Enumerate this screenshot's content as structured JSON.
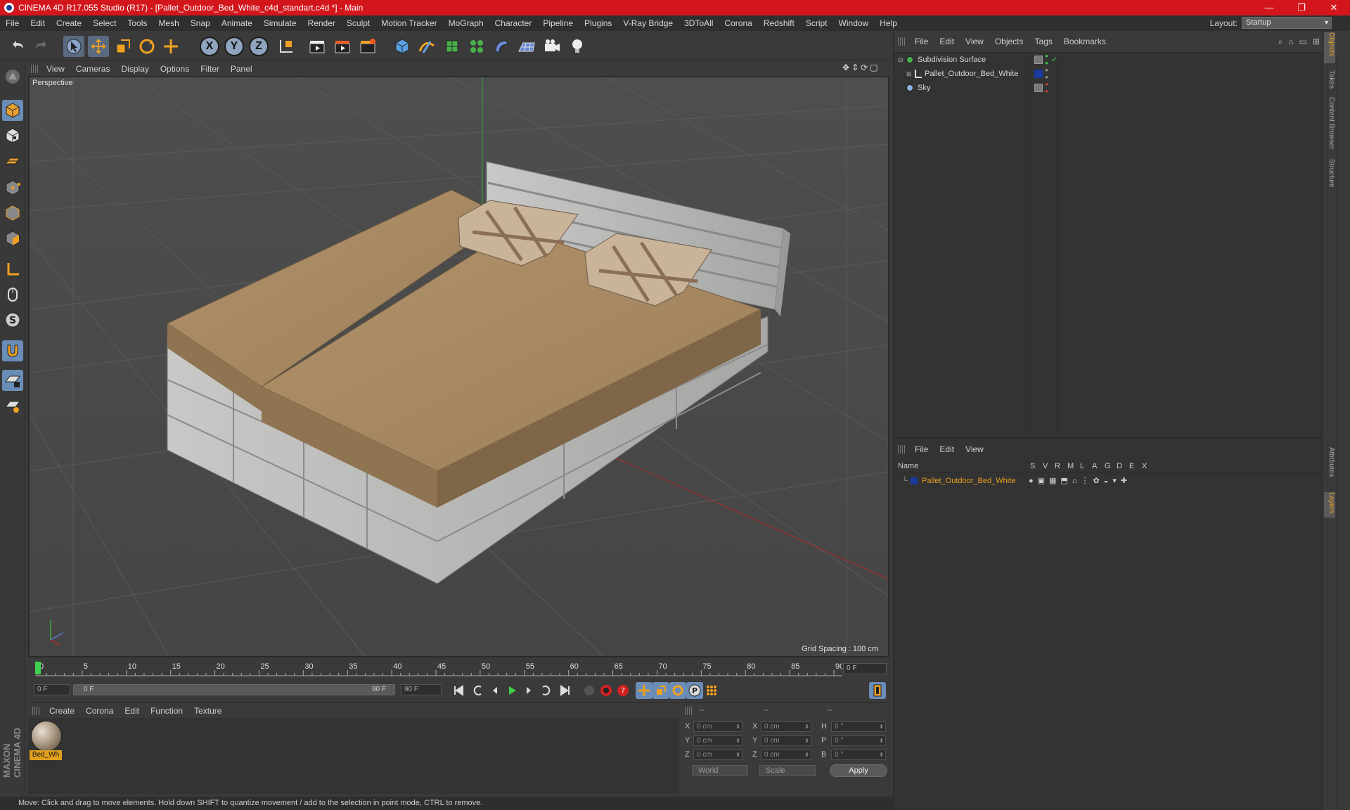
{
  "window": {
    "title": "CINEMA 4D R17.055 Studio (R17) - [Pallet_Outdoor_Bed_White_c4d_standart.c4d *] - Main",
    "controls": [
      "—",
      "❐",
      "✕"
    ]
  },
  "menu": [
    "File",
    "Edit",
    "Create",
    "Select",
    "Tools",
    "Mesh",
    "Snap",
    "Animate",
    "Simulate",
    "Render",
    "Sculpt",
    "Motion Tracker",
    "MoGraph",
    "Character",
    "Pipeline",
    "Plugins",
    "V-Ray Bridge",
    "3DToAll",
    "Corona",
    "Redshift",
    "Script",
    "Window",
    "Help"
  ],
  "layout": {
    "label": "Layout:",
    "value": "Startup"
  },
  "toolbar": {
    "axes": [
      "X",
      "Y",
      "Z"
    ]
  },
  "viewport": {
    "menu": [
      "View",
      "Cameras",
      "Display",
      "Options",
      "Filter",
      "Panel"
    ],
    "label": "Perspective",
    "grid_spacing": "Grid Spacing : 100 cm"
  },
  "timeline": {
    "ticks": [
      "0",
      "5",
      "10",
      "15",
      "20",
      "25",
      "30",
      "35",
      "40",
      "45",
      "50",
      "55",
      "60",
      "65",
      "70",
      "75",
      "80",
      "85",
      "90"
    ],
    "current_frame": "0 F"
  },
  "transport": {
    "start": "0 F",
    "range_start": "0 F",
    "range_end": "90 F",
    "end": "90 F"
  },
  "materials": {
    "menu": [
      "Create",
      "Corona",
      "Edit",
      "Function",
      "Texture"
    ],
    "items": [
      {
        "name": "Bed_Wh"
      }
    ]
  },
  "coordinates": {
    "header": [
      "--",
      "--",
      "--"
    ],
    "rows": [
      {
        "a": "X",
        "av": "0 cm",
        "b": "X",
        "bv": "0 cm",
        "c": "H",
        "cv": "0 °"
      },
      {
        "a": "Y",
        "av": "0 cm",
        "b": "Y",
        "bv": "0 cm",
        "c": "P",
        "cv": "0 °"
      },
      {
        "a": "Z",
        "av": "0 cm",
        "b": "Z",
        "bv": "0 cm",
        "c": "B",
        "cv": "0 °"
      }
    ],
    "mode": "World",
    "transform": "Scale",
    "apply": "Apply"
  },
  "status": "Move: Click and drag to move elements. Hold down SHIFT to quantize movement / add to the selection in point mode, CTRL to remove.",
  "objects": {
    "menu": [
      "File",
      "Edit",
      "View",
      "Objects",
      "Tags",
      "Bookmarks"
    ],
    "items": [
      {
        "name": "Subdivision Surface"
      },
      {
        "name": "Pallet_Outdoor_Bed_White"
      },
      {
        "name": "Sky"
      }
    ]
  },
  "layers": {
    "menu": [
      "File",
      "Edit",
      "View"
    ],
    "columns": [
      "Name",
      "S",
      "V",
      "R",
      "M",
      "L",
      "A",
      "G",
      "D",
      "E",
      "X"
    ],
    "items": [
      {
        "name": "Pallet_Outdoor_Bed_White"
      }
    ]
  },
  "side_tabs": [
    "Objects",
    "Takes",
    "Content Browser",
    "Structure",
    "Attributes",
    "Layers"
  ],
  "logo": "MAXON CINEMA 4D",
  "colors": {
    "titlebar": "#d3151c",
    "accent": "#e8a020",
    "layer_color": "#1a3aa0"
  }
}
